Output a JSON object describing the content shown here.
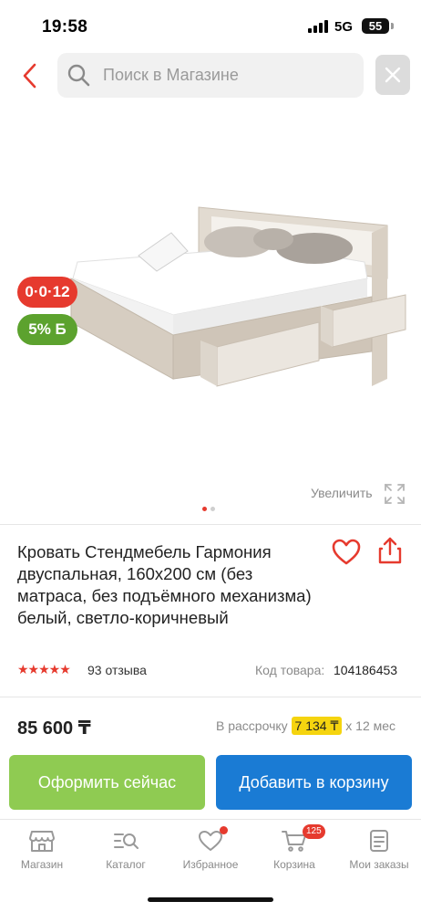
{
  "status_bar": {
    "time": "19:58",
    "network": "5G",
    "battery": "55"
  },
  "search": {
    "placeholder": "Поиск в Магазине"
  },
  "product": {
    "promo_badge": "0·0·12",
    "bonus_badge": "5% Б",
    "zoom_label": "Увеличить",
    "image_dots": 2,
    "active_dot": 0,
    "title": "Кровать Стендмебель Гармония двуспальная, 160x200 см (без матраса, без подъёмного механизма) белый, светло-коричневый",
    "rating": 5,
    "reviews": "93 отзыва",
    "code_label": "Код товара:",
    "code_value": "104186453"
  },
  "price": {
    "value": "85 600 ₸",
    "installment_prefix": "В рассрочку",
    "installment_amount": "7 134 ₸",
    "installment_suffix": "x 12 мес"
  },
  "actions": {
    "checkout_label": "Оформить сейчас",
    "cart_label": "Добавить в корзину"
  },
  "bottom_nav": {
    "items": [
      {
        "label": "Магазин",
        "icon": "shop-icon"
      },
      {
        "label": "Каталог",
        "icon": "catalog-search-icon"
      },
      {
        "label": "Избранное",
        "icon": "heart-icon"
      },
      {
        "label": "Корзина",
        "icon": "cart-icon"
      },
      {
        "label": "Мои заказы",
        "icon": "orders-icon"
      }
    ],
    "cart_count": "125"
  },
  "colors": {
    "accent_red": "#e63a2e",
    "green": "#8fcb52",
    "blue": "#1a7bd4",
    "yellow": "#f5d40f"
  }
}
